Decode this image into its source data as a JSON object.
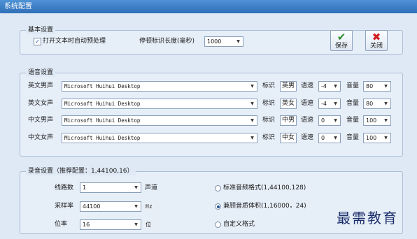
{
  "window": {
    "title": "系统配置"
  },
  "basic": {
    "group_title": "基本设置",
    "auto_preprocess_label": "打开文本时自动预处理",
    "auto_preprocess_checked": true,
    "pause_label": "停顿标识长度(毫秒)",
    "pause_value": "1000"
  },
  "buttons": {
    "save_label": "保存",
    "close_label": "关闭"
  },
  "voice": {
    "group_title": "语音设置",
    "mark_label": "标识",
    "speed_label": "语速",
    "volume_label": "音量",
    "rows": [
      {
        "name": "英文男声",
        "engine": "Microsoft Huihui Desktop",
        "mark": "英男",
        "speed": "-4",
        "volume": "80"
      },
      {
        "name": "英文女声",
        "engine": "Microsoft Huihui Desktop",
        "mark": "英女",
        "speed": "-4",
        "volume": "80"
      },
      {
        "name": "中文男声",
        "engine": "Microsoft Huihui Desktop",
        "mark": "中男",
        "speed": "0",
        "volume": "100"
      },
      {
        "name": "中文女声",
        "engine": "Microsoft Huihui Desktop",
        "mark": "中女",
        "speed": "0",
        "volume": "100"
      }
    ]
  },
  "recording": {
    "group_title": "录音设置（推荐配置：1,44100,16）",
    "lines_label": "线路数",
    "lines_value": "1",
    "channel_label": "声道",
    "rate_label": "采样率",
    "rate_value": "44100",
    "rate_unit": "Hz",
    "bits_label": "位率",
    "bits_value": "16",
    "bits_unit": "位",
    "options": [
      {
        "label": "标准音频格式(1,44100,128)",
        "selected": false
      },
      {
        "label": "兼顾音质体积(1,16000，24)",
        "selected": true
      },
      {
        "label": "自定义格式",
        "selected": false
      }
    ]
  },
  "watermark": "最需教育"
}
